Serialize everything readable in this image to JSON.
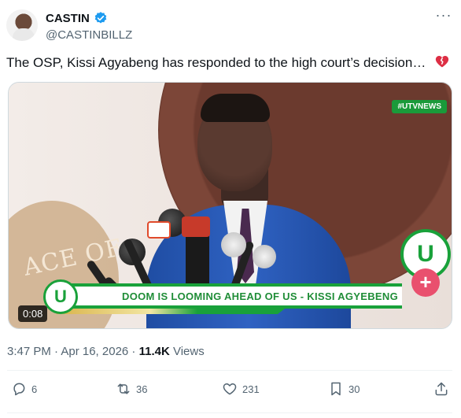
{
  "author": {
    "display_name": "CASTIN",
    "handle": "@CASTINBILLZ",
    "verified_icon": "verified-badge-icon"
  },
  "more_label": "···",
  "tweet": {
    "text": "The OSP, Kissi Agyabeng has responded to the high court’s decision…",
    "emoji_icon": "broken-heart-icon"
  },
  "media": {
    "watermark": "#UTVNEWS",
    "ticker": "DOOM IS LOOMING AHEAD OF US - KISSI AGYEBENG",
    "duration": "0:08",
    "logo_letter": "U",
    "seal_text": "ACE OF",
    "colors": {
      "brand_green": "#19a13a",
      "suit_blue": "#2f62c2",
      "plus_pink": "#e9506e"
    }
  },
  "meta": {
    "timestamp": "3:47 PM · Apr 16, 2026 · ",
    "views_count": "11.4K",
    "views_label": " Views"
  },
  "actions": {
    "reply": {
      "icon": "reply-icon",
      "count": "6"
    },
    "repost": {
      "icon": "repost-icon",
      "count": "36"
    },
    "like": {
      "icon": "heart-icon",
      "count": "231"
    },
    "bookmark": {
      "icon": "bookmark-icon",
      "count": "30"
    },
    "share": {
      "icon": "share-icon"
    }
  }
}
